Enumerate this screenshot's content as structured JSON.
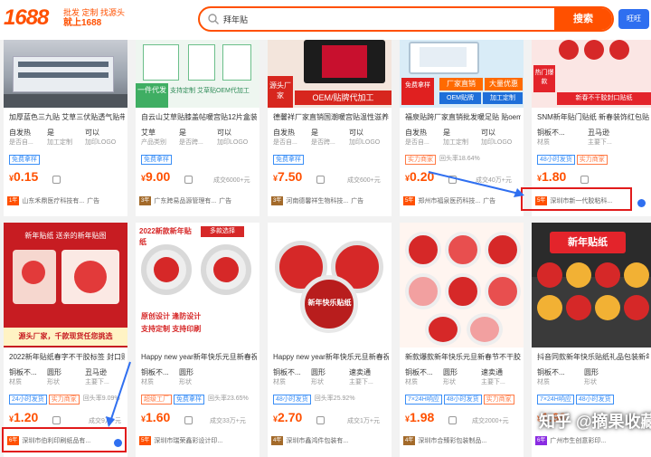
{
  "header": {
    "logo": "1688",
    "slogan_line1": "批发 定制 找源头",
    "slogan_line2": "就上1688",
    "search_value": "拜年贴",
    "search_button": "搜索",
    "side_button": "旺旺"
  },
  "cards_top": [
    {
      "title": "加厚蓝色三九贴 艾草三伏贴透气贴带",
      "a1": "自发热",
      "a1s": "是否自...",
      "a2": "是",
      "a2s": "加工定制",
      "a3": "可以",
      "a3s": "加印LOGO",
      "tags": [
        "免费拿样"
      ],
      "price": "0.15",
      "sold": "",
      "year": "1年",
      "shop": "山东禾鼎医疗科技有...",
      "shop_extra": "广告"
    },
    {
      "title": "自云山艾草贴膝盖帖暖宫贴12片盒装关",
      "a1": "艾草",
      "a1s": "产品类别",
      "a2": "是",
      "a2s": "是否跨...",
      "a3": "可以",
      "a3s": "加印LOGO",
      "tags": [
        "免费拿样"
      ],
      "price": "9.00",
      "sold": "成交6000+元",
      "year": "3年",
      "shop": "广东跨易品源管理有...",
      "shop_extra": "广告"
    },
    {
      "title": "德馨祥厂家直销国潮暖宫贴温性滋养保",
      "a1": "自发热",
      "a1s": "是否自...",
      "a2": "是",
      "a2s": "是否跨...",
      "a3": "可以",
      "a3s": "加印LOGO",
      "tags": [
        "免费拿样"
      ],
      "price": "7.50",
      "sold": "成交600+元",
      "year": "3年",
      "shop": "河南德馨祥生物科技...",
      "shop_extra": "广告"
    },
    {
      "title": "福泉贴跨厂家直销批发暖足贴 贴oem贴",
      "a1": "自发热",
      "a1s": "是否自...",
      "a2": "是",
      "a2s": "加工定制",
      "a3": "可以",
      "a3s": "加印LOGO",
      "tags": [
        "实力商家",
        "回头率18.64%"
      ],
      "price": "0.20",
      "sold": "成交40万+元",
      "year": "5年",
      "shop": "郑州市福泉医药科技...",
      "shop_extra": "广告"
    },
    {
      "title": "SNM新年贴门贴纸 新春装饰红包贴纸",
      "a1": "铜板不...",
      "a1s": "材质",
      "a2": "丑马逊",
      "a2s": "主要下...",
      "a3": "",
      "a3s": "",
      "tags": [
        "48小时发货",
        "实力商家"
      ],
      "price": "1.80",
      "sold": "",
      "year": "5年",
      "shop": "深圳市新一代胶粘科...",
      "shop_extra": ""
    }
  ],
  "cards_bottom": [
    {
      "title": "2022新年贴纸春字不干胶标签 封口贴",
      "a1": "铜板不...",
      "a1s": "材质",
      "a2": "圆形",
      "a2s": "形状",
      "a3": "丑马逊",
      "a3s": "主要下...",
      "tags": [
        "24小时发货",
        "实力商家",
        "回头率9.09%"
      ],
      "price": "1.20",
      "sold": "成交9万+元",
      "year": "6年",
      "shop": "深圳市伯利印刷纸品有..."
    },
    {
      "title": "Happy new year新年快乐元旦新春祝",
      "a1": "铜板不...",
      "a1s": "材质",
      "a2": "圆形",
      "a2s": "形状",
      "a3": "",
      "a3s": "",
      "tags": [
        "超级工厂",
        "免费拿样",
        "回头率23.65%"
      ],
      "price": "1.60",
      "sold": "成交33万+元",
      "year": "5年",
      "shop": "深圳市瑞荣鑫彩设计印..."
    },
    {
      "title": "Happy new year新年快乐元旦新春祝",
      "a1": "铜板不...",
      "a1s": "材质",
      "a2": "圆形",
      "a2s": "形状",
      "a3": "速卖通",
      "a3s": "主要下...",
      "tags": [
        "48小时发货",
        "回头率25.92%"
      ],
      "price": "2.70",
      "sold": "成交1万+元",
      "year": "4年",
      "shop": "深圳市鑫鸿件包装有..."
    },
    {
      "title": "新款爆款新年快乐元旦新春节不干胶标",
      "a1": "铜板不...",
      "a1s": "材质",
      "a2": "圆形",
      "a2s": "形状",
      "a3": "速卖通",
      "a3s": "主要下...",
      "tags": [
        "7×24H响应",
        "48小时发货",
        "实力商家"
      ],
      "price": "1.98",
      "sold": "成交2000+元",
      "year": "4年",
      "shop": "深圳市合臻彩包装制品..."
    },
    {
      "title": "抖音同款新年快乐贴纸礼品包装新年快乐圆",
      "a1": "铜板不...",
      "a1s": "材质",
      "a2": "圆形",
      "a2s": "形状",
      "a3": "",
      "a3s": "",
      "tags": [
        "7×24H响应",
        "48小时发货"
      ],
      "price": "1.98",
      "sold": "",
      "year": "6年",
      "shop": "广州市生创意彩印..."
    }
  ],
  "img_texts": {
    "t2_left": "一件代发",
    "t2_right": "支持定制 艾草贴OEM代加工",
    "t3_left": "源头厂家",
    "t3_right": "OEM/贴牌代加工",
    "t4_a": "厂家直销",
    "t4_b": "大量优惠",
    "t4_c": "免费拿样",
    "t4_d": "OEM贴牌",
    "t4_e": "加工定制",
    "t5_a": "热门爆款",
    "t5_b": "新春不干胶封口贴纸",
    "b1_a": "新年贴纸 送亲的新年贴图",
    "b1_b": "源头厂家，千款现货任您挑选",
    "b2_a": "2022新款新年贴纸",
    "b2_b": "多款选择",
    "b2_c": "原创设计 逢防设计",
    "b2_d": "支持定制 支持印刷",
    "b3_a": "新年快乐贴纸",
    "b5_a": "新年贴纸"
  },
  "watermark": "知乎 @摘果收藏",
  "colors": {
    "brand": "#ff5000",
    "price": "#ff5000",
    "highlight_box": "#e11b1b",
    "tag_blue": "#3a8ef6"
  }
}
